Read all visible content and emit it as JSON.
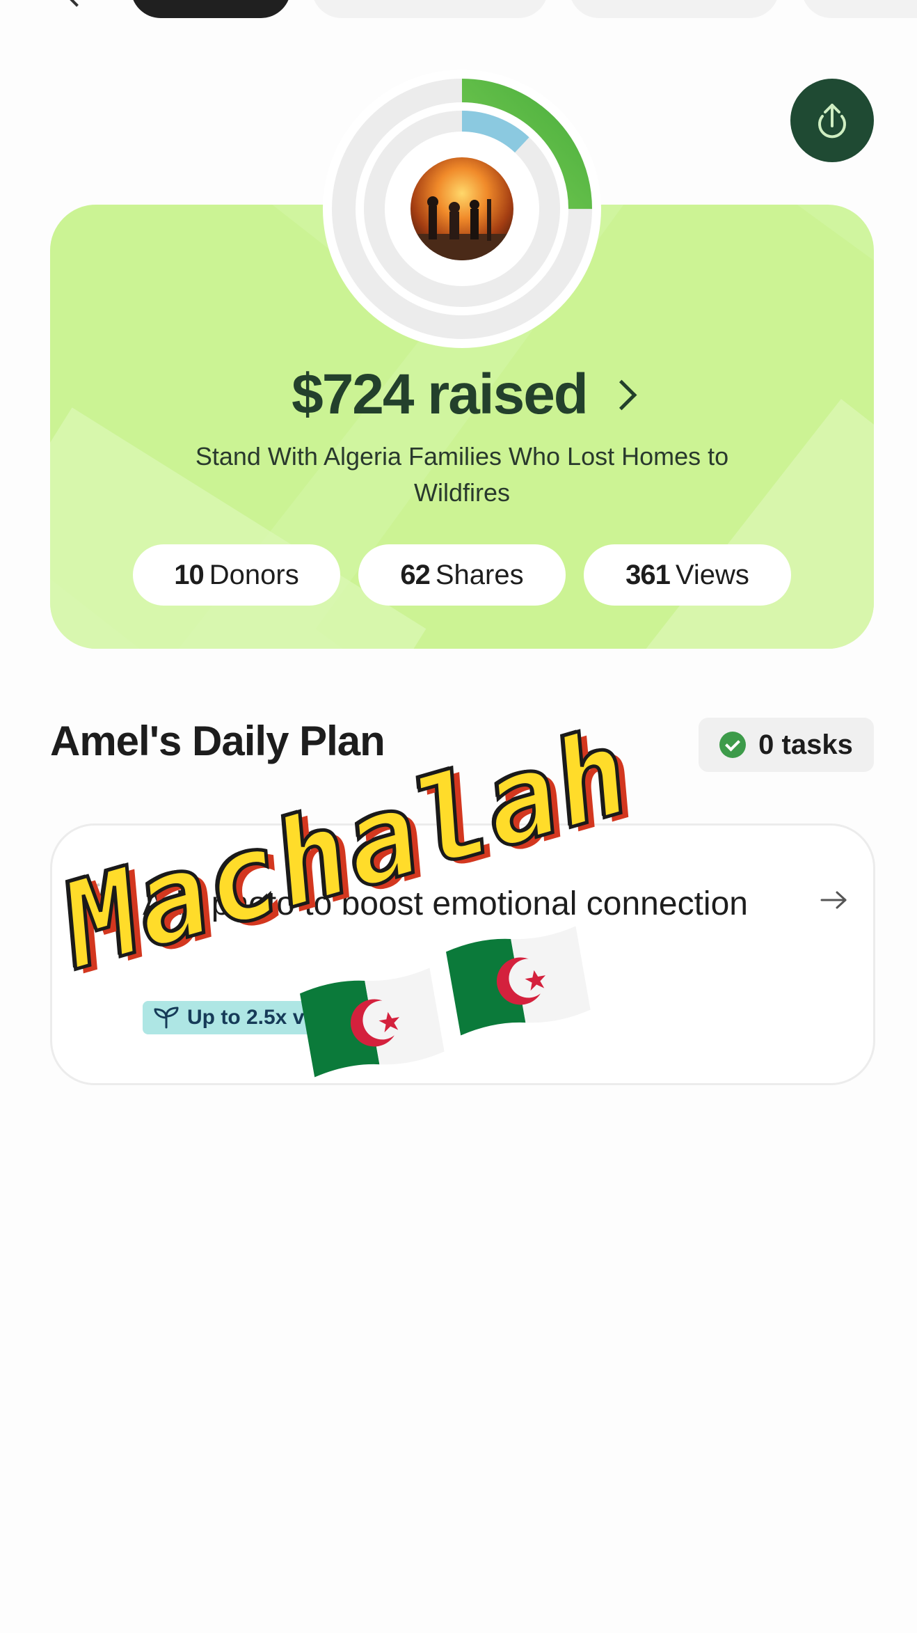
{
  "header": {
    "tabs": [
      {
        "label": "",
        "active": true
      },
      {
        "label": "",
        "active": false
      },
      {
        "label": "",
        "active": false
      },
      {
        "label": "",
        "active": false
      }
    ]
  },
  "hero": {
    "raised": "$724 raised",
    "campaign_title": "Stand With Algeria Families Who Lost Homes to Wildfires",
    "progress_fraction_outer": 0.25,
    "progress_fraction_inner": 0.12,
    "stats": [
      {
        "number": "10",
        "label": "Donors"
      },
      {
        "number": "62",
        "label": "Shares"
      },
      {
        "number": "361",
        "label": "Views"
      }
    ],
    "colors": {
      "card_bg": "#d0f59f",
      "text": "#23402c",
      "ring_green": "#4caf3e",
      "ring_blue": "#8bc9e0"
    }
  },
  "plan": {
    "title": "Amel's Daily Plan",
    "tasks_badge": "0 tasks",
    "task": {
      "text": "Add photo to boost emotional connection",
      "badge": "Up to 2.5x views"
    }
  },
  "sticker": {
    "text": "Machalah",
    "flags": [
      "algeria-flag",
      "algeria-flag"
    ]
  },
  "icons": [
    "back-chevron-icon",
    "share-icon",
    "chevron-right-icon",
    "check-icon",
    "dashed-circle-icon",
    "arrow-right-icon",
    "sprout-icon"
  ]
}
